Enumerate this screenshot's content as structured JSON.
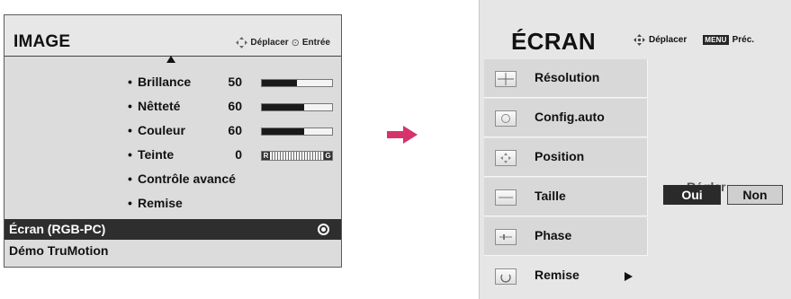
{
  "left_menu": {
    "title": "IMAGE",
    "hint_move": "Déplacer",
    "hint_enter": "Entrée",
    "options": [
      {
        "label": "Brillance",
        "value": "50",
        "level": 0.5
      },
      {
        "label": "Nêtteté",
        "value": "60",
        "level": 0.6
      },
      {
        "label": "Couleur",
        "value": "60",
        "level": 0.6
      },
      {
        "label": "Teinte",
        "value": "0",
        "tint_left": "R",
        "tint_right": "G"
      },
      {
        "label": "Contrôle avancé"
      },
      {
        "label": "Remise"
      }
    ],
    "selected_item": "Écran (RGB-PC)",
    "bottom_item": "Démo TruMotion"
  },
  "right_menu": {
    "title": "ÉCRAN",
    "hint_move": "Déplacer",
    "menu_badge": "MENU",
    "hint_back": "Préc.",
    "items": [
      {
        "label": "Résolution",
        "icon": "crosshair-icon"
      },
      {
        "label": "Config.auto",
        "icon": "auto-config-icon"
      },
      {
        "label": "Position",
        "icon": "position-arrows-icon"
      },
      {
        "label": "Taille",
        "icon": "size-icon"
      },
      {
        "label": "Phase",
        "icon": "phase-icon"
      },
      {
        "label": "Remise",
        "icon": "reset-icon"
      }
    ],
    "adjust_label": "Régler",
    "yes_label": "Oui",
    "no_label": "Non"
  },
  "colors": {
    "transition_arrow": "#d6336c",
    "selected_bg": "#2e2e2e"
  }
}
